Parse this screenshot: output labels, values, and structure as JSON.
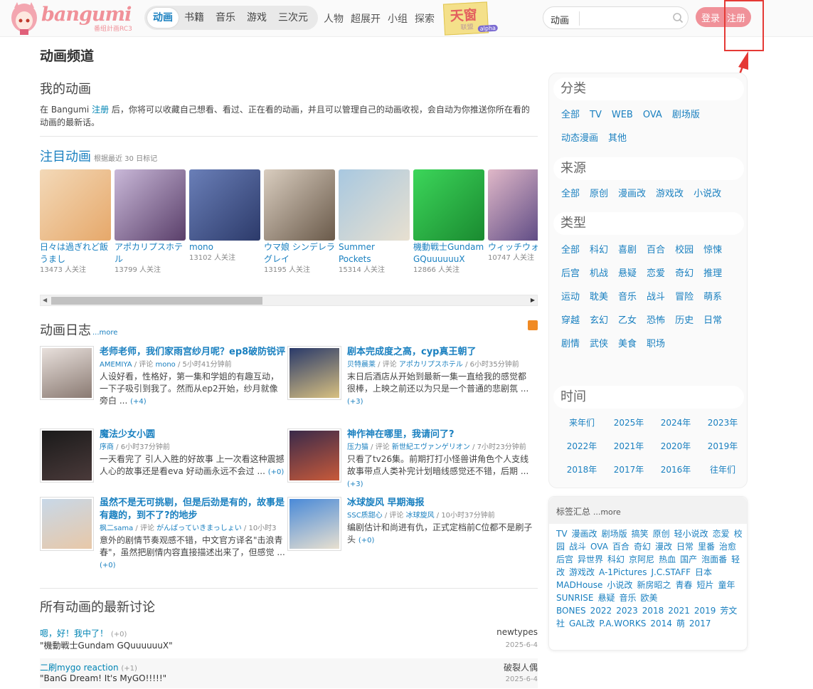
{
  "header": {
    "logo_text": "bangumi",
    "logo_sub": "番组計画RC3",
    "nav_main": [
      "动画",
      "书籍",
      "音乐",
      "游戏",
      "三次元"
    ],
    "nav_sub": [
      "人物",
      "超展开",
      "小组",
      "探索"
    ],
    "tianchuang": {
      "text": "天窗",
      "sub": "联盟",
      "badge": "alpha"
    },
    "search": {
      "category": "动画",
      "placeholder": ""
    },
    "login_label": "登录",
    "register_label": "注册"
  },
  "main": {
    "page_title": "动画频道",
    "my_anime": {
      "title": "我的动画",
      "intro_pre": "在 Bangumi ",
      "intro_link": "注册",
      "intro_post": " 后，你将可以收藏自己想看、看过、正在看的动画，并且可以管理自己的动画收视，会自动为你推送你所在看的动画的最新话。"
    },
    "watching": {
      "title": "注目动画",
      "note": "根据最近 30 日标记",
      "items": [
        {
          "name": "日々は過ぎれど飯うまし",
          "meta": "13473 人关注",
          "c1": "#f3d9b8",
          "c2": "#e6a86a"
        },
        {
          "name": "アポカリプスホテル",
          "meta": "13799 人关注",
          "c1": "#c9b8d8",
          "c2": "#5a3f6a"
        },
        {
          "name": "mono",
          "meta": "13102 人关注",
          "c1": "#6a7fb8",
          "c2": "#2c3a6a"
        },
        {
          "name": "ウマ娘 シンデレラグレイ",
          "meta": "13195 人关注",
          "c1": "#d9cdbf",
          "c2": "#6a5a4a"
        },
        {
          "name": "Summer Pockets",
          "meta": "15314 人关注",
          "c1": "#a8c8e0",
          "c2": "#e8e0d0"
        },
        {
          "name": "機動戦士Gundam GQuuuuuuX",
          "meta": "12866 人关注",
          "c1": "#3cd65a",
          "c2": "#1a8a30"
        },
        {
          "name": "ウィッチウォッチ",
          "meta": "10747 人关注",
          "c1": "#e0b8c8",
          "c2": "#4a3a7a"
        }
      ]
    },
    "blog": {
      "title": "动画日志",
      "more": "...more",
      "items": [
        {
          "title": "老师老师，我们家雨宫纱月呢？ep8破防锐评",
          "user": "AMEMIYA",
          "sep": " / 评论 ",
          "subject": "mono",
          "time": " / 5小时41分钟前",
          "text": "人设好看，性格好，第一集和学姐的有趣互动，一下子吸引到我了。然而从ep2开始，纱月就像旁白 ...",
          "rep": "(+4)",
          "c1": "#e8e0dc",
          "c2": "#8a7a72"
        },
        {
          "title": "剧本完成度之高，cyp真王朝了",
          "user": "贝特晨莱",
          "sep": " / 评论 ",
          "subject": "アポカリプスホテル",
          "time": " / 6小时35分钟前",
          "text": "末日后酒店从开始到最新一集一直给我的感觉都很棒，上映之前还以为只是一个普通的悲剧氛 ...",
          "rep": "(+3)",
          "c1": "#2a3a6a",
          "c2": "#d8c080"
        },
        {
          "title": "魔法少女小圆",
          "user": "序商",
          "sep": "",
          "subject": "",
          "time": " / 6小时37分钟前",
          "text": "一天看完了 引人入胜的好故事 上一次看这种震撼人心的故事还是看eva 好动画永远不会过 ...",
          "rep": "(+0)",
          "c1": "#1a1a1a",
          "c2": "#4a3a3a"
        },
        {
          "title": "神作神在哪里，我请问了?",
          "user": "压力猫",
          "sep": " / 评论 ",
          "subject": "新世紀エヴァンゲリオン",
          "time": " / 7小时23分钟前",
          "text": "只看了tv26集。前期打打小怪兽讲角色个人支线故事带点人类补完计划暗线感觉还不错，后期 ...",
          "rep": "(+3)",
          "c1": "#3a2a4a",
          "c2": "#c85a3a"
        },
        {
          "title": "虽然不是无可挑剔，但是后劲是有的，故事是有趣的，到不了?的地步",
          "user": "枫二sama",
          "sep": " / 评论 ",
          "subject": "がんばっていきまっしょい",
          "time": " / 10小时3",
          "text": "意外的剧情节奏观感不错，中文官方译名\"击浪青春\"，虽然把剧情内容直接描述出来了，但感觉 ...",
          "rep": "(+0)",
          "c1": "#c8d8e8",
          "c2": "#e8c8a8"
        },
        {
          "title": "冰球旋风 早期海报",
          "user": "SSC质甜心",
          "sep": " / 评论 ",
          "subject": "冰球旋风",
          "time": " / 10小时37分钟前",
          "text": "编剧估计和尚进有仇，正式定档前C位都不是刷子头",
          "rep": "(+0)",
          "c1": "#4a8ad8",
          "c2": "#e8e0d0"
        }
      ]
    },
    "discussions": {
      "title": "所有动画的最新讨论",
      "items": [
        {
          "title": "嗯，好！我中了！",
          "rep": "(+0)",
          "subject": "\"機動戦士Gundam GQuuuuuuX\"",
          "user": "newtypes",
          "date": "2025-6-4"
        },
        {
          "title": "二刷mygo reaction",
          "rep": "(+1)",
          "subject": "\"BanG Dream! It's MyGO!!!!!\"",
          "user": "破裂人偶",
          "date": "2025-6-4"
        }
      ]
    }
  },
  "sidebar": {
    "category": {
      "title": "分类",
      "links": [
        "全部",
        "TV",
        "WEB",
        "OVA",
        "剧场版",
        "动态漫画",
        "其他"
      ]
    },
    "source": {
      "title": "来源",
      "links": [
        "全部",
        "原创",
        "漫画改",
        "游戏改",
        "小说改"
      ]
    },
    "genre": {
      "title": "类型",
      "links": [
        "全部",
        "科幻",
        "喜剧",
        "百合",
        "校园",
        "惊悚",
        "后宫",
        "机战",
        "悬疑",
        "恋爱",
        "奇幻",
        "推理",
        "运动",
        "耽美",
        "音乐",
        "战斗",
        "冒险",
        "萌系",
        "穿越",
        "玄幻",
        "乙女",
        "恐怖",
        "历史",
        "日常",
        "剧情",
        "武侠",
        "美食",
        "职场"
      ]
    },
    "time": {
      "title": "时间",
      "links": [
        "来年们",
        "2025年",
        "2024年",
        "2023年",
        "2022年",
        "2021年",
        "2020年",
        "2019年",
        "2018年",
        "2017年",
        "2016年",
        "往年们"
      ]
    },
    "tags": {
      "title": "标签汇总",
      "more": "...more",
      "items": [
        "TV",
        "漫画改",
        "剧场版",
        "搞笑",
        "原创",
        "轻小说改",
        "恋爱",
        "校园",
        "战斗",
        "OVA",
        "百合",
        "奇幻",
        "漫改",
        "日常",
        "里番",
        "治愈",
        "后宫",
        "异世界",
        "科幻",
        "京阿尼",
        "热血",
        "国产",
        "泡面番",
        "轻改",
        "游戏改",
        "A-1Pictures",
        "J.C.STAFF",
        "日本",
        "MADHouse",
        "小说改",
        "新房昭之",
        "青春",
        "短片",
        "童年",
        "SUNRISE",
        "悬疑",
        "音乐",
        "欧美",
        "BONES",
        "2022",
        "2023",
        "2018",
        "2021",
        "2019",
        "芳文社",
        "GAL改",
        "P.A.WORKS",
        "2014",
        "萌",
        "2017"
      ]
    }
  },
  "colors": {
    "accent": "#f09199",
    "link": "#1a80c0",
    "annotation": "#e53935"
  }
}
